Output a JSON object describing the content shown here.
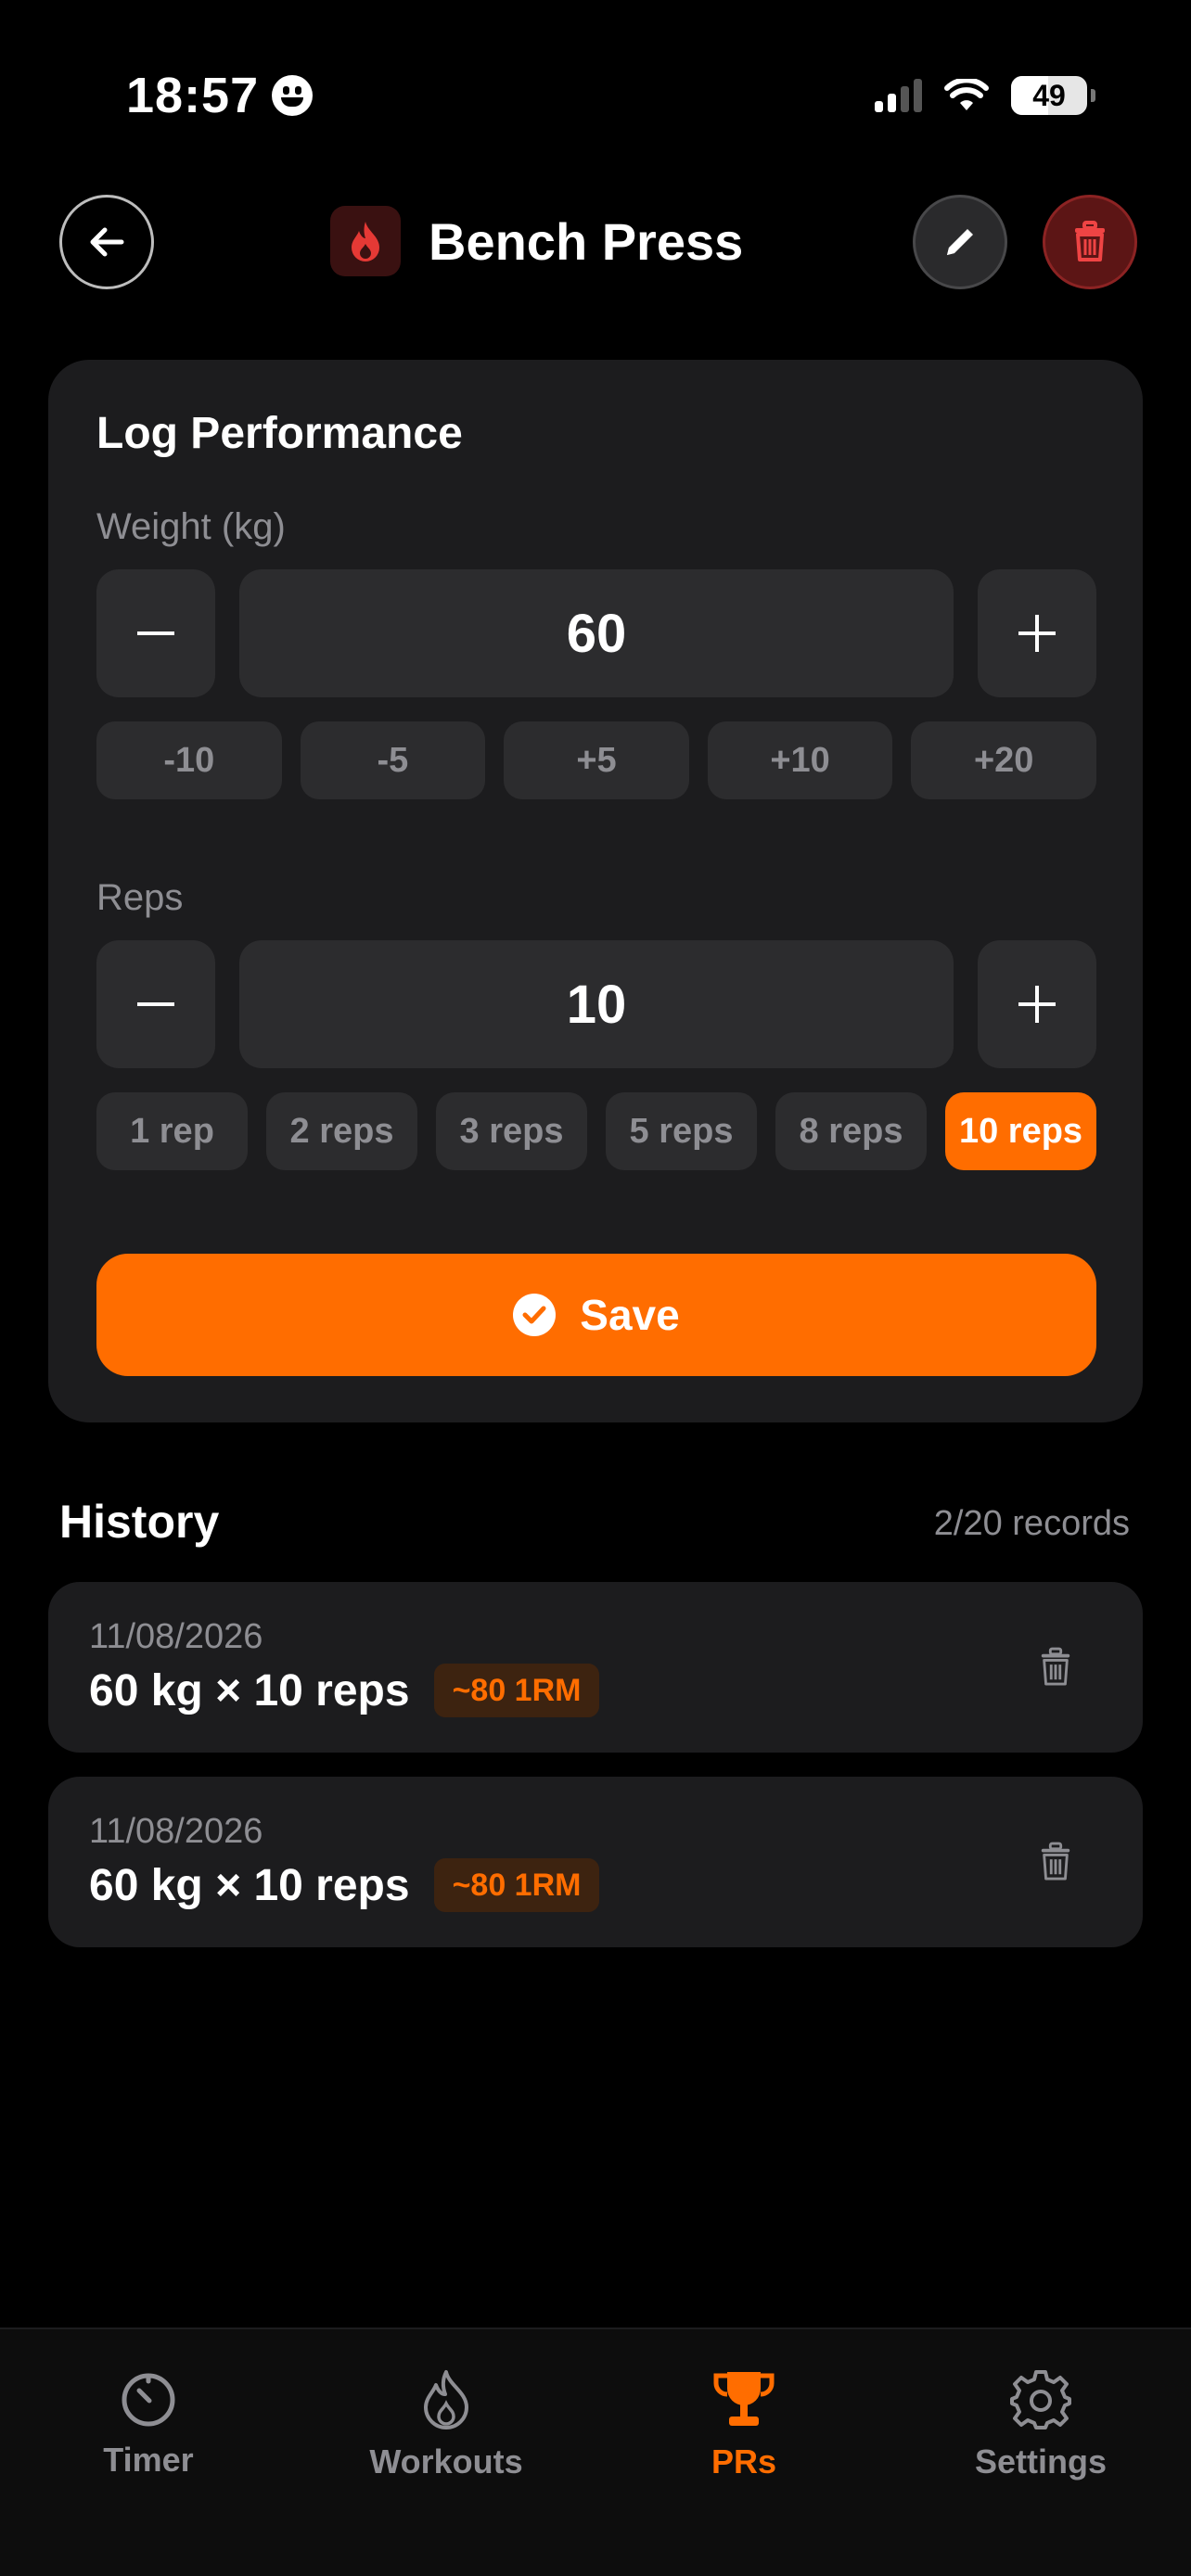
{
  "status_bar": {
    "time": "18:57",
    "battery": "49",
    "battery_level": 0.49
  },
  "header": {
    "title": "Bench Press"
  },
  "log": {
    "title": "Log Performance",
    "weight": {
      "label": "Weight (kg)",
      "value": "60",
      "minus": "−",
      "plus": "+",
      "quick": [
        "-10",
        "-5",
        "+5",
        "+10",
        "+20"
      ]
    },
    "reps": {
      "label": "Reps",
      "value": "10",
      "minus": "−",
      "plus": "+",
      "quick": [
        "1 rep",
        "2 reps",
        "3 reps",
        "5 reps",
        "8 reps",
        "10 reps"
      ],
      "selected": "10 reps"
    },
    "save_label": "Save"
  },
  "history": {
    "title": "History",
    "count": "2/20 records",
    "records": [
      {
        "date": "11/08/2026",
        "value": "60 kg × 10 reps",
        "badge": "~80 1RM"
      },
      {
        "date": "11/08/2026",
        "value": "60 kg × 10 reps",
        "badge": "~80 1RM"
      }
    ]
  },
  "tabs": [
    {
      "label": "Timer",
      "icon": "timer-icon",
      "active": false
    },
    {
      "label": "Workouts",
      "icon": "flame-icon",
      "active": false
    },
    {
      "label": "PRs",
      "icon": "trophy-icon",
      "active": true
    },
    {
      "label": "Settings",
      "icon": "gear-icon",
      "active": false
    }
  ],
  "colors": {
    "accent": "#ff6d00",
    "card": "#1c1c1e",
    "danger": "#e53935"
  }
}
